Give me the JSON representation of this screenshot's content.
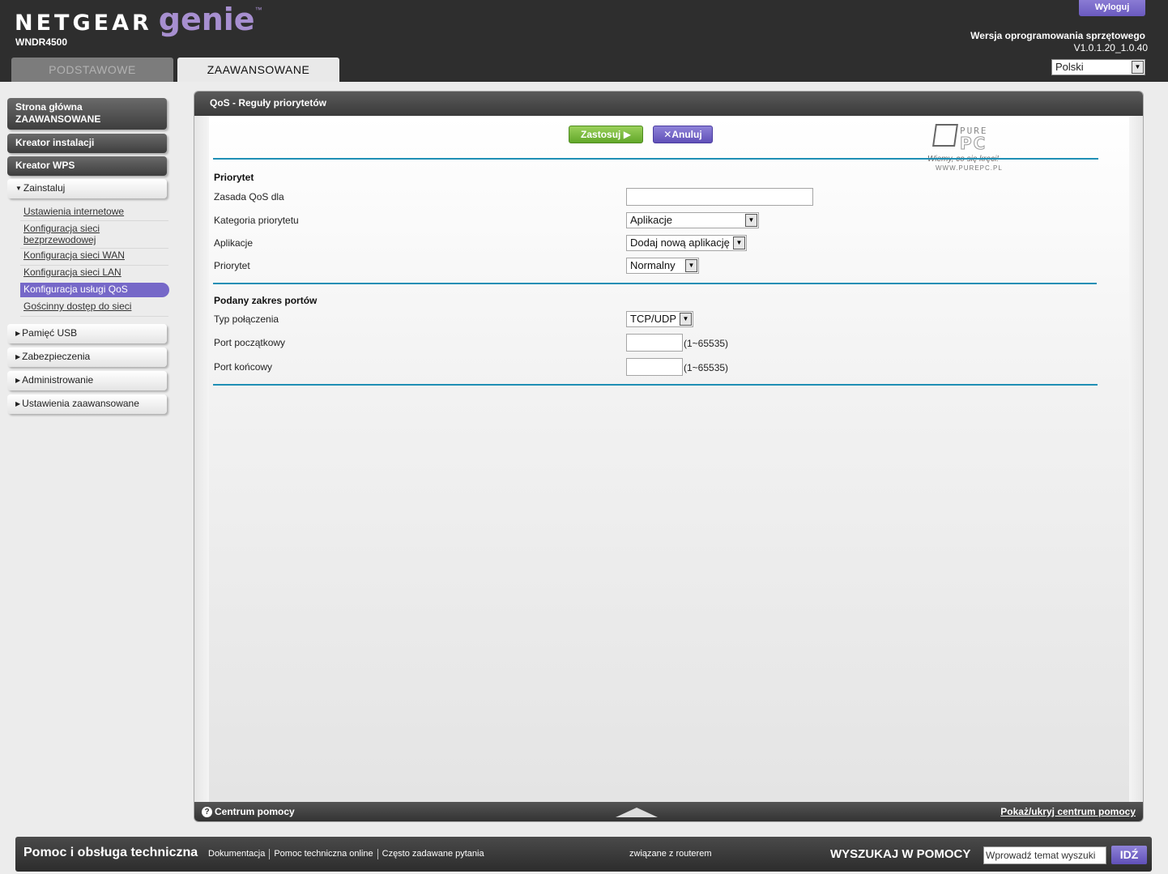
{
  "header": {
    "brand": "NETGEAR",
    "product": "genie",
    "trademark": "™",
    "model": "WNDR4500",
    "logout_label": "Wyloguj",
    "firmware_label": "Wersja oprogramowania sprzętowego",
    "firmware_version": "V1.0.1.20_1.0.40",
    "language": "Polski",
    "tabs": [
      {
        "label": "PODSTAWOWE",
        "active": false
      },
      {
        "label": "ZAAWANSOWANE",
        "active": true
      }
    ]
  },
  "sidebar": {
    "home_line1": "Strona główna",
    "home_line2": "ZAAWANSOWANE",
    "setup_wizard": "Kreator instalacji",
    "wps_wizard": "Kreator WPS",
    "install": "Zainstaluj",
    "install_items": [
      "Ustawienia internetowe",
      "Konfiguracja sieci bezprzewodowej",
      "Konfiguracja sieci WAN",
      "Konfiguracja sieci LAN",
      "Konfiguracja usługi QoS",
      "Gościnny dostęp do sieci"
    ],
    "active_item": "Konfiguracja usługi QoS",
    "usb": "Pamięć USB",
    "security": "Zabezpieczenia",
    "admin": "Administrowanie",
    "advanced": "Ustawienia zaawansowane"
  },
  "panel": {
    "title": "QoS - Reguły priorytetów",
    "apply_label": "Zastosuj",
    "cancel_label": "Anuluj",
    "watermark": {
      "pure": "PURE",
      "pc": "PC",
      "slogan": "Wiemy, co się kręci!",
      "url": "WWW.PUREPC.PL"
    },
    "priority_section": "Priorytet",
    "qos_policy_label": "Zasada QoS dla",
    "qos_policy_value": "",
    "category_label": "Kategoria priorytetu",
    "category_value": "Aplikacje",
    "apps_label": "Aplikacje",
    "apps_value": "Dodaj nową aplikację",
    "priority_label": "Priorytet",
    "priority_value": "Normalny",
    "ports_section": "Podany zakres portów",
    "conn_type_label": "Typ połączenia",
    "conn_type_value": "TCP/UDP",
    "start_port_label": "Port początkowy",
    "end_port_label": "Port końcowy",
    "port_range": "(1~65535)",
    "help_center": "Centrum pomocy",
    "help_toggle": "Pokaż/ukryj centrum pomocy"
  },
  "footer": {
    "title": "Pomoc i obsługa techniczna",
    "links": [
      "Dokumentacja",
      "Pomoc techniczna online",
      "Często zadawane pytania"
    ],
    "router_text": "związane z routerem",
    "search_label": "WYSZUKAJ W POMOCY",
    "search_placeholder": "Wprowadź temat wyszuki",
    "go_label": "IDŹ"
  },
  "colors": {
    "accent_purple": "#7668c8",
    "apply_green": "#62a82a",
    "divider_blue": "#1f8fb5",
    "header_dark": "#2e2e2e"
  }
}
